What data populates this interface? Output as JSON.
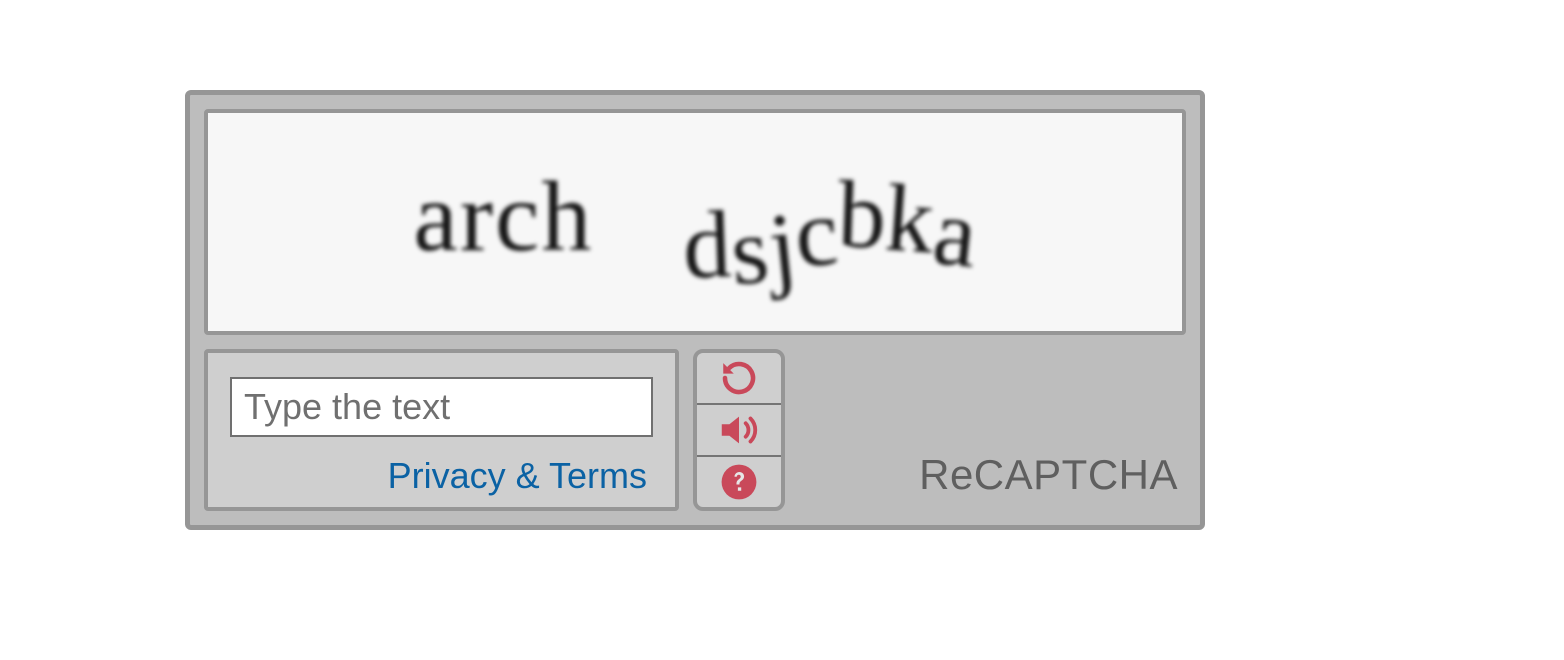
{
  "captcha": {
    "challenge_word_1": "arch",
    "challenge_word_2": "dsjcbka",
    "input_placeholder": "Type the text",
    "input_value": "",
    "privacy_link_label": "Privacy & Terms",
    "brand_label": "ReCAPTCHA",
    "buttons": {
      "reload_icon": "reload-icon",
      "audio_icon": "audio-icon",
      "help_icon": "help-icon"
    },
    "colors": {
      "widget_border": "#969696",
      "widget_bg": "#bdbdbd",
      "panel_bg": "#cfcfcf",
      "icon_accent": "#c9495a",
      "link_color": "#0b62a4",
      "brand_color": "#5f5f5f"
    }
  }
}
